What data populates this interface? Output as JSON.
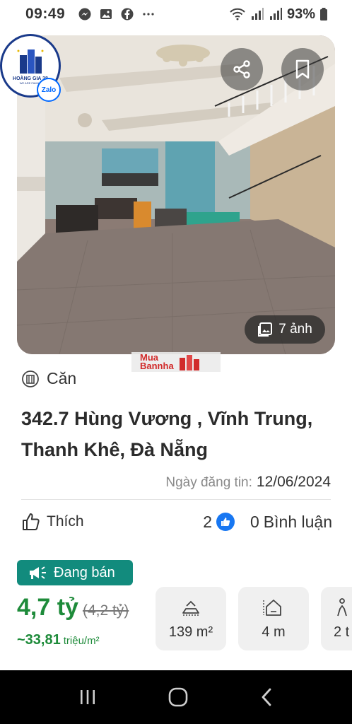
{
  "status_bar": {
    "time": "09:49",
    "notification_icons": [
      "messenger-icon",
      "gallery-icon",
      "facebook-icon",
      "more-dots-icon"
    ],
    "battery": "93%"
  },
  "hero": {
    "photo_count": "7 ảnh"
  },
  "logo": {
    "name": "HOÀNG GIA 38",
    "tagline": "WE ARE FAMILY",
    "zalo": "Zalo"
  },
  "watermark": {
    "line1": "Mua",
    "line2": "Bannha"
  },
  "listing": {
    "category": "Căn",
    "address": "342.7 Hùng Vương , Vĩnh Trung, Thanh Khê, Đà Nẵng",
    "posted_label": "Ngày đăng tin:",
    "posted_date": "12/06/2024"
  },
  "actions": {
    "like_label": "Thích",
    "like_count": "2",
    "comment_count": "0",
    "comment_label": "Bình luận"
  },
  "sale": {
    "badge": "Đang bán",
    "price": "4,7 tỷ",
    "old_price": "(4,2 tỷ)",
    "price_per_m2": "~33,81",
    "price_per_m2_unit": "triệu/m²"
  },
  "specs": [
    {
      "icon": "area-icon",
      "value": "139 m²"
    },
    {
      "icon": "frontage-icon",
      "value": "4 m"
    },
    {
      "icon": "floors-icon",
      "value": "2 t"
    }
  ],
  "colors": {
    "accent_teal": "#128b7d",
    "price_green": "#1e8b3a",
    "like_blue": "#1877f2"
  }
}
